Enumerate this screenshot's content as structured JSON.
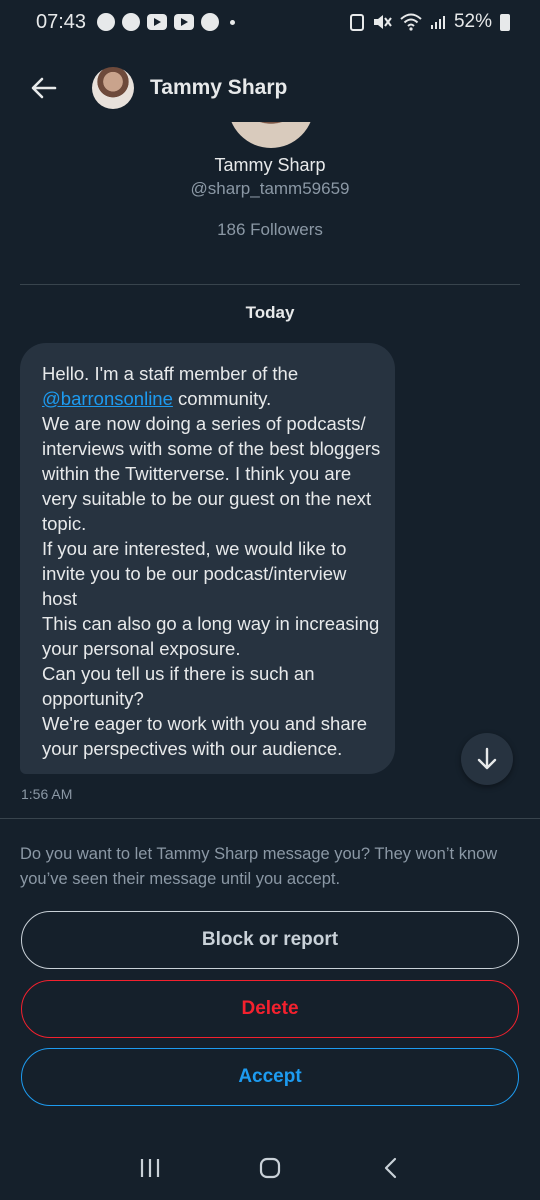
{
  "status_bar": {
    "time": "07:43",
    "battery": "52%",
    "left_icons": [
      "signal-messenger-icon",
      "chat-bubble-icon",
      "youtube-icon",
      "youtube-icon",
      "gear-leaf-icon"
    ],
    "right_icons": [
      "vpn-icon",
      "mute-icon",
      "wifi-icon",
      "cell-signal-icon",
      "battery-icon"
    ]
  },
  "header": {
    "title": "Tammy Sharp",
    "back_icon": "arrow-left-icon"
  },
  "profile": {
    "name": "Tammy Sharp",
    "handle": "@sharp_tamm59659",
    "followers": "186 Followers"
  },
  "conversation": {
    "day_label": "Today",
    "message": {
      "line1": "Hello. I'm a staff member of the",
      "mention": "@barronsonline",
      "line2_rest": " community.",
      "para2": "We are now doing a series of podcasts/ interviews with some of the best bloggers within the Twitterverse. I think you are very suitable to be our guest on the next topic.",
      "para3": "If you are interested, we would like to invite you to be our podcast/interview host",
      "para4": "This can also go a long way in increasing your personal exposure.",
      "para5": "Can you tell us if there is such an opportunity?",
      "para6": "We're eager to work with you and share your perspectives with our audience.",
      "time": "1:56 AM"
    }
  },
  "request": {
    "prompt": "Do you want to let Tammy Sharp message you? They won’t know you’ve seen their message until you accept.",
    "block_label": "Block or report",
    "delete_label": "Delete",
    "accept_label": "Accept"
  },
  "colors": {
    "background": "#15202b",
    "bubble": "#273340",
    "link": "#1d9bf0",
    "danger": "#f4212e",
    "muted": "#8b98a5"
  }
}
